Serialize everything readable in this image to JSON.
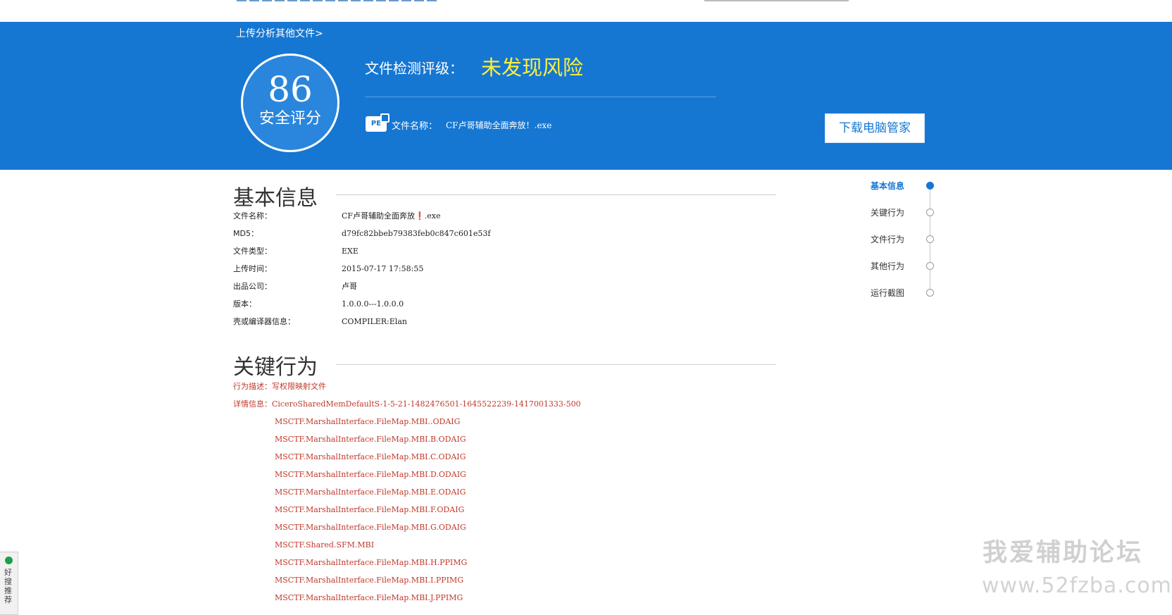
{
  "banner": {
    "upload_link": "上传分析其他文件>",
    "score_value": "86",
    "score_label": "安全评分",
    "rating_label": "文件检测评级：",
    "rating_value": "未发现风险",
    "pe_badge": "PE",
    "file_label": "文件名称：",
    "file_value": "CF卢哥辅助全面奔放！.exe",
    "download_button": "下载电脑管家"
  },
  "basic_info": {
    "title": "基本信息",
    "rows": [
      {
        "label": "文件名称：",
        "value": "CF卢哥辅助全面奔放❗.exe"
      },
      {
        "label": "MD5：",
        "value": "d79fc82bbeb79383feb0c847c601e53f"
      },
      {
        "label": "文件类型：",
        "value": "EXE"
      },
      {
        "label": "上传时间：",
        "value": "2015-07-17 17:58:55"
      },
      {
        "label": "出品公司：",
        "value": "卢哥"
      },
      {
        "label": "版本：",
        "value": "1.0.0.0---1.0.0.0"
      },
      {
        "label": "壳或编译器信息：",
        "value": "COMPILER:Elan"
      }
    ]
  },
  "key_behavior": {
    "title": "关键行为",
    "desc_label": "行为描述：",
    "desc_value": "写权限映射文件",
    "detail_label": "详情信息：",
    "detail_first": "CiceroSharedMemDefaultS-1-5-21-1482476501-1645522239-1417001333-500",
    "details": [
      "MSCTF.MarshalInterface.FileMap.MBI..ODAIG",
      "MSCTF.MarshalInterface.FileMap.MBI.B.ODAIG",
      "MSCTF.MarshalInterface.FileMap.MBI.C.ODAIG",
      "MSCTF.MarshalInterface.FileMap.MBI.D.ODAIG",
      "MSCTF.MarshalInterface.FileMap.MBI.E.ODAIG",
      "MSCTF.MarshalInterface.FileMap.MBI.F.ODAIG",
      "MSCTF.MarshalInterface.FileMap.MBI.G.ODAIG",
      "MSCTF.Shared.SFM.MBI",
      "MSCTF.MarshalInterface.FileMap.MBI.H.PPIMG",
      "MSCTF.MarshalInterface.FileMap.MBI.I.PPIMG",
      "MSCTF.MarshalInterface.FileMap.MBI.J.PPIMG"
    ]
  },
  "nav": {
    "items": [
      {
        "label": "基本信息",
        "active": true
      },
      {
        "label": "关键行为",
        "active": false
      },
      {
        "label": "文件行为",
        "active": false
      },
      {
        "label": "其他行为",
        "active": false
      },
      {
        "label": "运行截图",
        "active": false
      }
    ]
  },
  "watermark": {
    "text": "我爱辅助论坛",
    "url": "www.52fzba.com"
  },
  "side_tab": {
    "label": "好搜推荐"
  },
  "colors": {
    "banner_blue": "#1677d2",
    "rating_yellow": "#ffef3b",
    "behavior_red": "#c0392b"
  }
}
